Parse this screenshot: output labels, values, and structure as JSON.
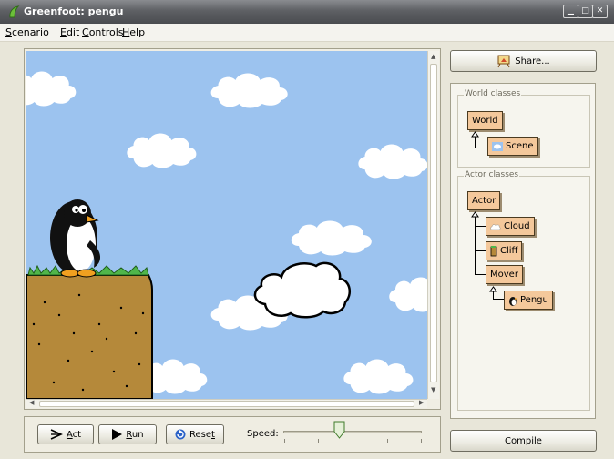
{
  "window": {
    "title": "Greenfoot: pengu"
  },
  "menu": [
    {
      "underline": "S",
      "rest": "cenario"
    },
    {
      "underline": "E",
      "rest": "dit"
    },
    {
      "underline": "C",
      "rest": "ontrols"
    },
    {
      "underline": "H",
      "rest": "elp"
    }
  ],
  "share_button": {
    "label": "Share..."
  },
  "world_classes": {
    "title": "World classes",
    "root": "World",
    "children": [
      "Scene"
    ]
  },
  "actor_classes": {
    "title": "Actor classes",
    "root": "Actor",
    "children": [
      "Cloud",
      "Cliff",
      "Mover"
    ],
    "grandchildren": [
      "Pengu"
    ]
  },
  "controls": {
    "act": {
      "underline": "A",
      "rest": "ct"
    },
    "run": {
      "underline": "R",
      "rest": "un"
    },
    "reset": {
      "pre": "Rese",
      "underline": "t"
    },
    "speed_label": "Speed:",
    "speed_fraction": 0.4
  },
  "compile_button": {
    "label": "Compile"
  },
  "colors": {
    "sky": "#9cc3ef",
    "class_box": "#f4c89b",
    "dirt": "#b5893a"
  }
}
